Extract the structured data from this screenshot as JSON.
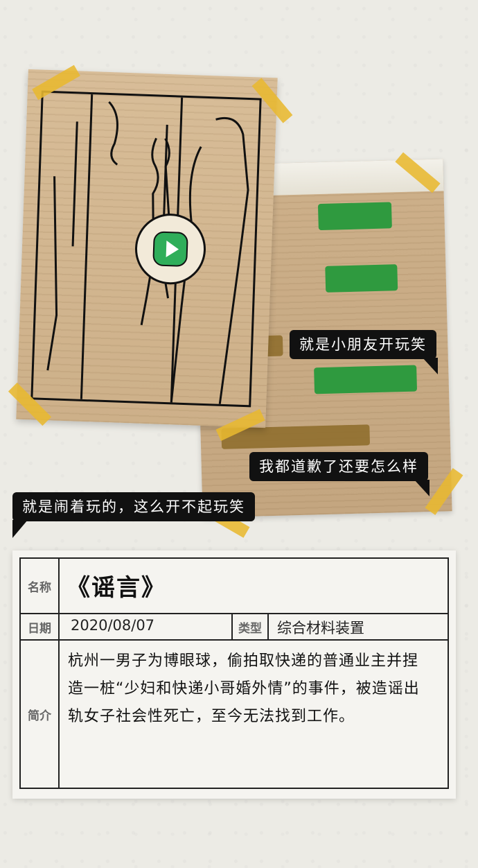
{
  "speech": {
    "line1": "就是小朋友开玩笑",
    "line2": "我都道歉了还要怎么样",
    "line3": "就是闹着玩的，这么开不起玩笑"
  },
  "info": {
    "name_label": "名称",
    "name_value": "《谣言》",
    "date_label": "日期",
    "date_value": "2020/08/07",
    "type_label": "类型",
    "type_value": "综合材料装置",
    "intro_label": "简介",
    "intro_text": "杭州一男子为博眼球，偷拍取快递的普通业主并捏造一桩“少妇和快递小哥婚外情”的事件，被造谣出轨女子社会性死亡，至今无法找到工作。"
  },
  "colors": {
    "tape": "#e8b830",
    "chat_green": "#2f9a3f",
    "chat_brown": "#8f6e2e",
    "play_green": "#2fae5a"
  },
  "icons": {
    "play": "play-icon"
  }
}
